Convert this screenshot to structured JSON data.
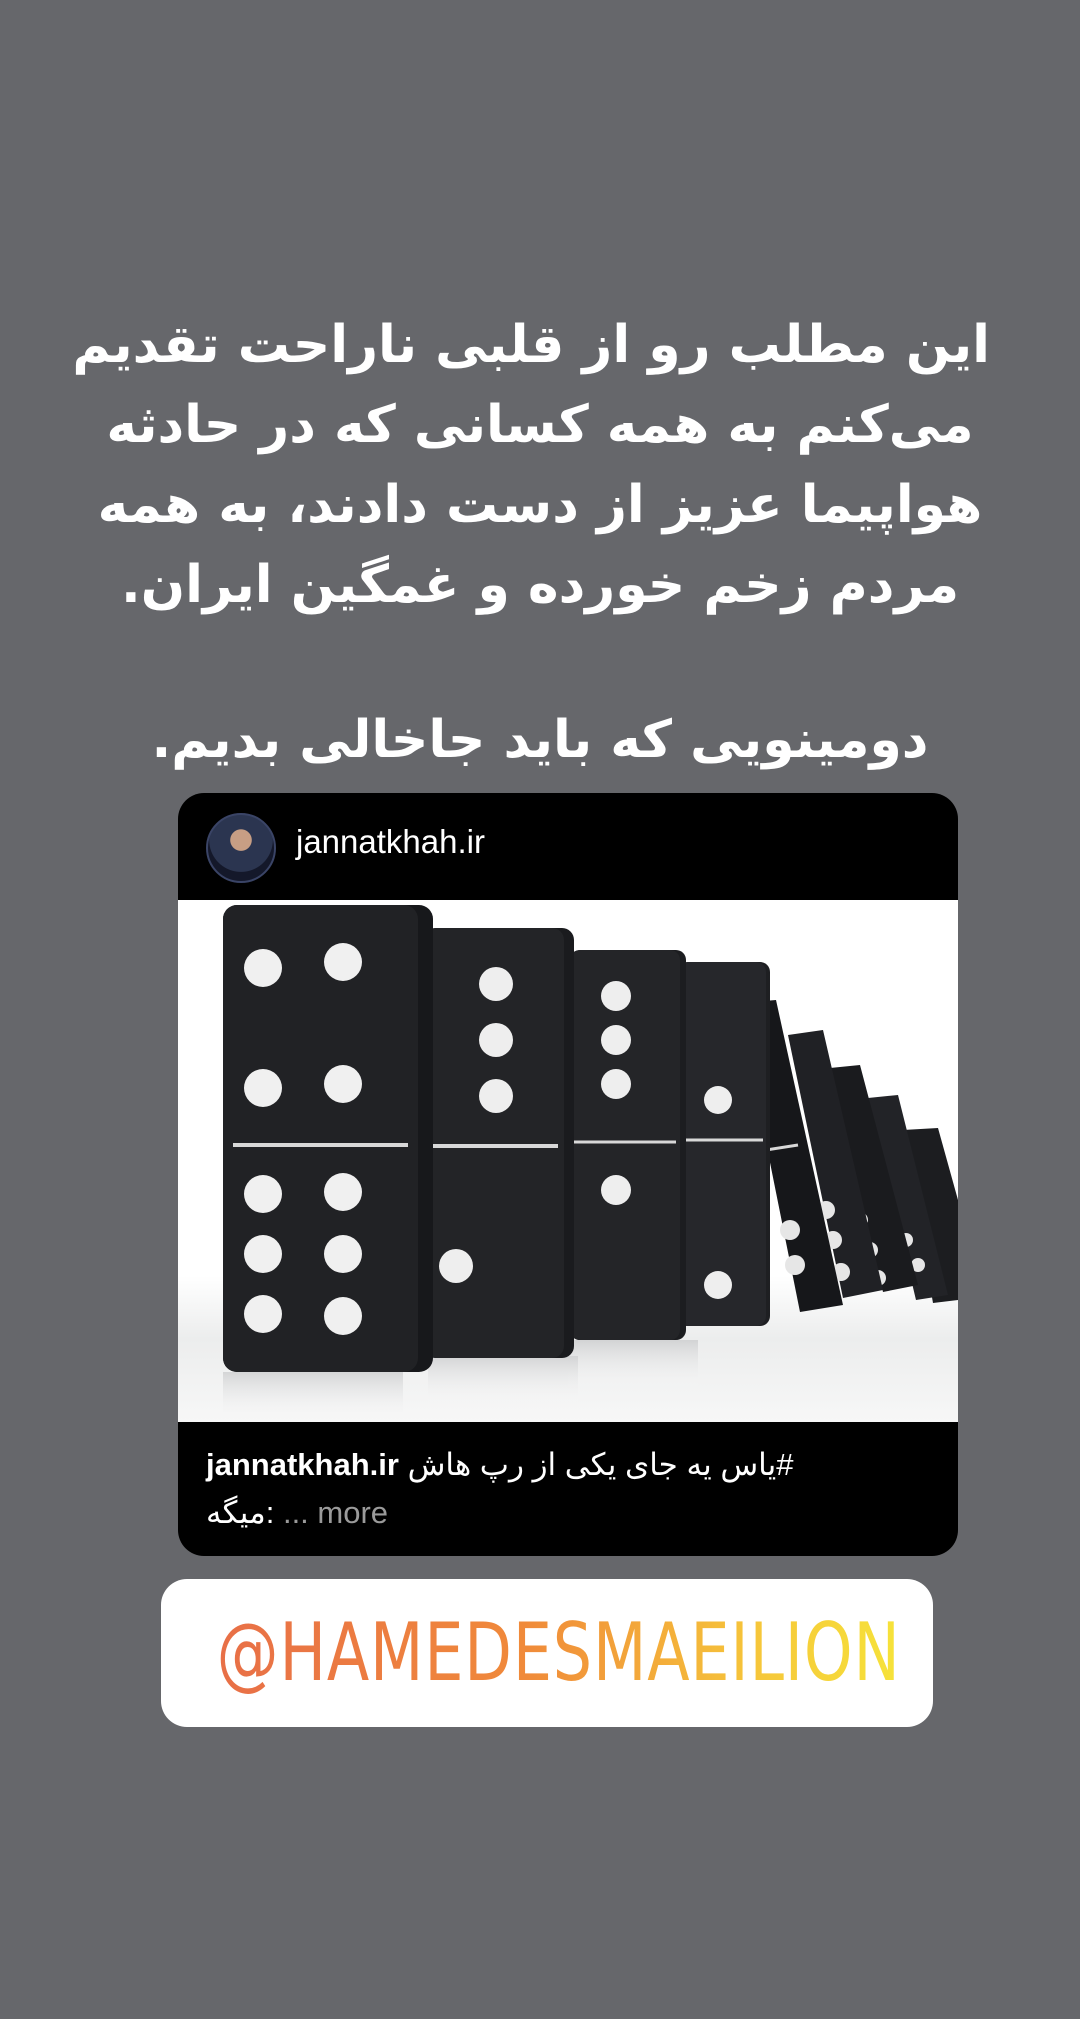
{
  "story": {
    "lines": [
      "این مطلب رو از قلبی ناراحت تقدیم",
      "می‌کنم به همه کسانی که در حادثه",
      "هواپیما عزیز از دست دادند، به همه",
      "مردم زخم خورده و غمگین ایران."
    ],
    "closing_line": "دومینویی که باید جاخالی بدیم."
  },
  "post": {
    "username": "jannatkhah.ir",
    "caption_user": "jannatkhah.ir",
    "caption_text": "#یاس یه جای یکی از رپ هاش",
    "caption_text_line2": "میگه:",
    "more_label": "... more"
  },
  "mention": {
    "text": "@HAMEDESMAEILION"
  },
  "colors": {
    "background": "#66676b",
    "card": "#000000",
    "mention_gradient_start": "#e86f47",
    "mention_gradient_end": "#f6e33a"
  },
  "icons": {
    "avatar": "profile-avatar"
  }
}
